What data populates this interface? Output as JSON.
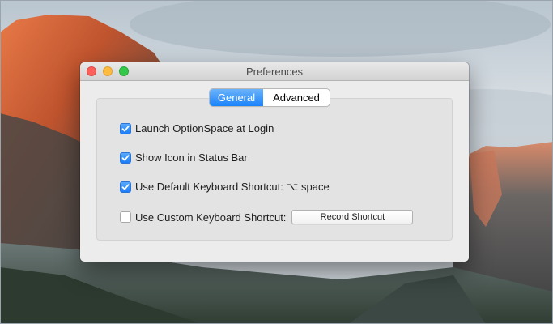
{
  "window": {
    "title": "Preferences"
  },
  "tabs": [
    {
      "label": "General",
      "active": true
    },
    {
      "label": "Advanced",
      "active": false
    }
  ],
  "options": [
    {
      "label": "Launch OptionSpace at Login",
      "checked": true
    },
    {
      "label": "Show Icon in Status Bar",
      "checked": true
    },
    {
      "label": "Use Default Keyboard Shortcut: ⌥ space",
      "checked": true
    },
    {
      "label": "Use Custom Keyboard Shortcut:",
      "checked": false
    }
  ],
  "record_button": {
    "label": "Record Shortcut"
  },
  "icons": {
    "checkmark": "checkmark-icon",
    "close": "close-button",
    "minimize": "minimize-button",
    "zoom": "zoom-button"
  },
  "colors": {
    "accent": "#1a82fb",
    "close": "#fc605b",
    "minimize": "#fdbc40",
    "zoom": "#34c84a"
  }
}
